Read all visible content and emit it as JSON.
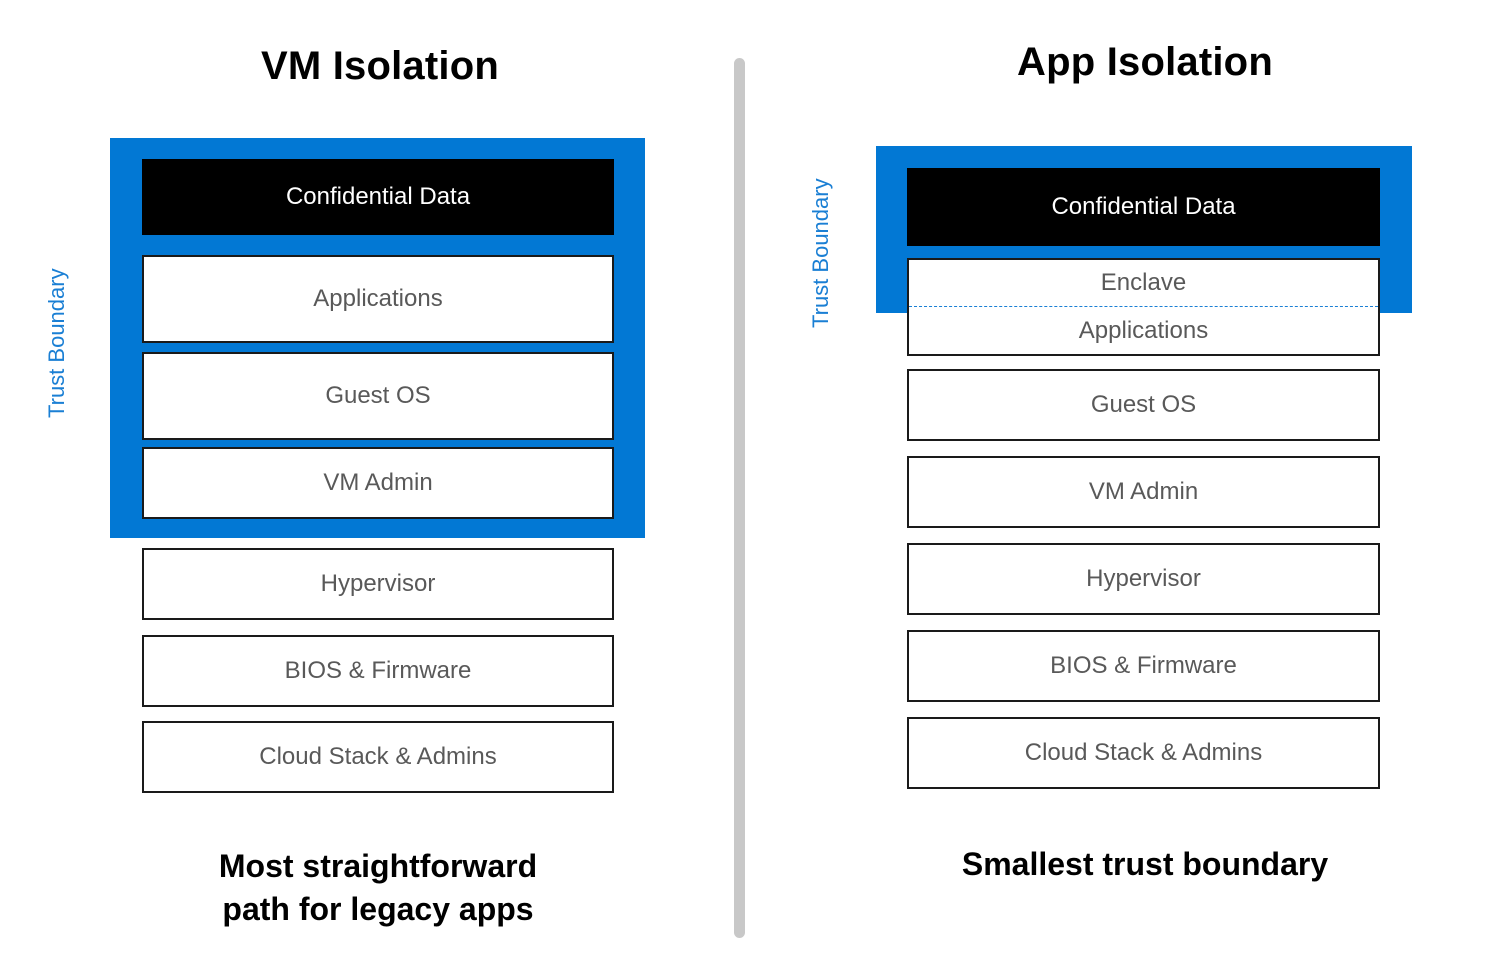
{
  "panels": {
    "left": {
      "title": "VM Isolation",
      "trust_boundary_label": "Trust Boundary",
      "caption_line1": "Most straightforward",
      "caption_line2": "path for legacy apps",
      "stack": [
        {
          "label": "Confidential Data",
          "style": "confidential",
          "inside_boundary": true
        },
        {
          "label": "Applications",
          "style": "plain",
          "inside_boundary": true
        },
        {
          "label": "Guest OS",
          "style": "plain",
          "inside_boundary": true
        },
        {
          "label": "VM Admin",
          "style": "plain",
          "inside_boundary": true
        },
        {
          "label": "Hypervisor",
          "style": "plain",
          "inside_boundary": false
        },
        {
          "label": "BIOS & Firmware",
          "style": "plain",
          "inside_boundary": false
        },
        {
          "label": "Cloud Stack & Admins",
          "style": "plain",
          "inside_boundary": false
        }
      ]
    },
    "right": {
      "title": "App Isolation",
      "trust_boundary_label": "Trust Boundary",
      "caption_line1": "Smallest trust boundary",
      "caption_line2": "",
      "stack": [
        {
          "label": "Confidential Data",
          "style": "confidential",
          "inside_boundary": true
        },
        {
          "label_top": "Enclave",
          "label_bottom": "Applications",
          "style": "split",
          "inside_boundary": "partial"
        },
        {
          "label": "Guest OS",
          "style": "plain",
          "inside_boundary": false
        },
        {
          "label": "VM Admin",
          "style": "plain",
          "inside_boundary": false
        },
        {
          "label": "Hypervisor",
          "style": "plain",
          "inside_boundary": false
        },
        {
          "label": "BIOS & Firmware",
          "style": "plain",
          "inside_boundary": false
        },
        {
          "label": "Cloud Stack & Admins",
          "style": "plain",
          "inside_boundary": false
        }
      ]
    }
  },
  "colors": {
    "trust_boundary_blue": "#0278D4",
    "trust_boundary_label_blue": "#1A7FD4",
    "confidential_black": "#000000",
    "box_text_gray": "#595959",
    "divider_gray": "#C8C8C8"
  }
}
